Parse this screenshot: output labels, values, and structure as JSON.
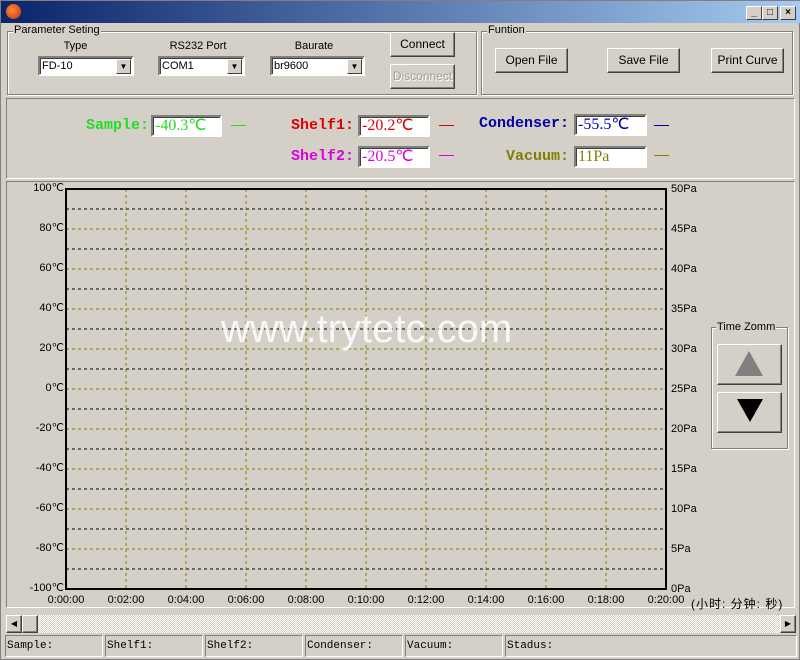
{
  "window": {
    "icon": "tomato-app-icon",
    "controls": [
      "_",
      "□",
      "×"
    ]
  },
  "parameter_group": {
    "title": "Parameter Seting",
    "type": {
      "label": "Type",
      "value": "FD-10"
    },
    "port": {
      "label": "RS232 Port",
      "value": "COM1"
    },
    "baud": {
      "label": "Baurate",
      "value": "br9600"
    },
    "connect": "Connect",
    "disconnect": "Disconnect"
  },
  "function_group": {
    "title": "Funtion",
    "open": "Open File",
    "save": "Save File",
    "print": "Print Curve"
  },
  "readouts": {
    "sample": {
      "label": "Sample:",
      "value": "-40.3℃",
      "color": "#22dd22"
    },
    "shelf1": {
      "label": "Shelf1:",
      "value": "-20.2℃",
      "color": "#dd0000"
    },
    "shelf2": {
      "label": "Shelf2:",
      "value": "-20.5℃",
      "color": "#dd00dd"
    },
    "condenser": {
      "label": "Condenser:",
      "value": "-55.5℃",
      "color": "#0000aa"
    },
    "vacuum": {
      "label": "Vacuum:",
      "value": "11Pa",
      "color": "#808000"
    }
  },
  "chart": {
    "left_ticks": [
      "100℃",
      "80℃",
      "60℃",
      "40℃",
      "20℃",
      "0℃",
      "-20℃",
      "-40℃",
      "-60℃",
      "-80℃",
      "-100℃"
    ],
    "right_ticks": [
      "50Pa",
      "45Pa",
      "40Pa",
      "35Pa",
      "30Pa",
      "25Pa",
      "20Pa",
      "15Pa",
      "10Pa",
      "5Pa",
      "0Pa"
    ],
    "x_ticks": [
      "0:00:00",
      "0:02:00",
      "0:04:00",
      "0:06:00",
      "0:08:00",
      "0:10:00",
      "0:12:00",
      "0:14:00",
      "0:16:00",
      "0:18:00",
      "0:20:00"
    ],
    "x_unit": "(小时: 分钟: 秒)",
    "watermark": "www.trytetc.com",
    "grid_color": "#808000"
  },
  "time_zoom": {
    "title": "Time Zomm",
    "up_icon": "triangle-up-icon",
    "down_icon": "triangle-down-icon"
  },
  "status_bar": [
    "Sample:",
    "Shelf1:",
    "Shelf2:",
    "Condenser:",
    "Vacuum:",
    "Stadus:"
  ]
}
